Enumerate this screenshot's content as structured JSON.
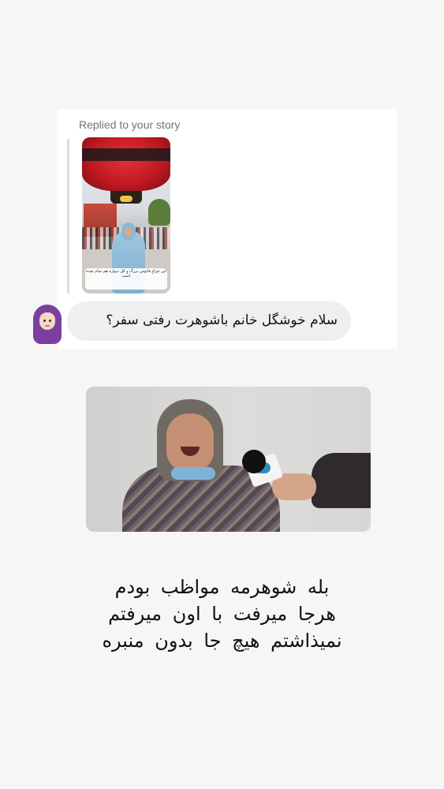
{
  "reply_card": {
    "header": "Replied to your story",
    "story_caption": "این چراغ فانوس بزرگ و کل دیواره هم تمام شده است",
    "message": "سلام خوشگل خانم باشوهرت رفتی سفر؟",
    "avatar_icon": "woman-with-headscarf-emoji-icon"
  },
  "video": {
    "description_icon": "interview-video-thumbnail"
  },
  "caption": {
    "lines": [
      "بله شوهرمه مواظب بودم",
      "هرجا میرفت با اون میرفتم",
      "نمیذاشتم هیچ جا بدون منبره"
    ]
  },
  "colors": {
    "background": "#f6f6f6",
    "bubble": "#efefef",
    "lantern_red": "#c21a22",
    "hijab_purple": "#7b3fa0"
  }
}
